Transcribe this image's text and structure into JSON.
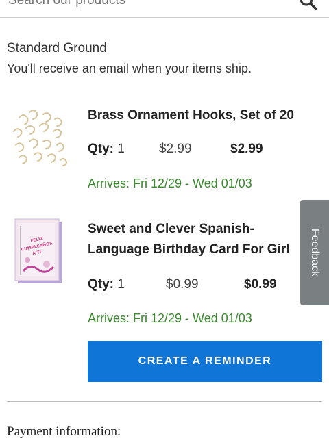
{
  "search": {
    "placeholder": "Search our products",
    "icon": "search-icon"
  },
  "shipping": {
    "method": "Standard Ground",
    "note": "You'll receive an email when your items ship."
  },
  "items": [
    {
      "name": "Brass Ornament Hooks, Set of 20",
      "qty_label": "Qty:",
      "qty": "1",
      "unit_price": "$2.99",
      "total_price": "$2.99",
      "arrives": "Arrives: Fri 12/29 - Wed 01/03",
      "image": "brass-hooks-image"
    },
    {
      "name": "Sweet and Clever Spanish-Language Birthday Card For Girl",
      "qty_label": "Qty:",
      "qty": "1",
      "unit_price": "$0.99",
      "total_price": "$0.99",
      "arrives": "Arrives: Fri 12/29 - Wed 01/03",
      "image": "birthday-card-image",
      "image_text": "FELIZ CUMPLEAÑOS A TI"
    }
  ],
  "actions": {
    "create_reminder": "CREATE A REMINDER"
  },
  "payment": {
    "title": "Payment information:"
  },
  "feedback": {
    "label": "Feedback"
  },
  "colors": {
    "accent": "#0f76d8",
    "arrival_green": "#3a8a2e",
    "feedback_tab": "#7a7f82"
  }
}
